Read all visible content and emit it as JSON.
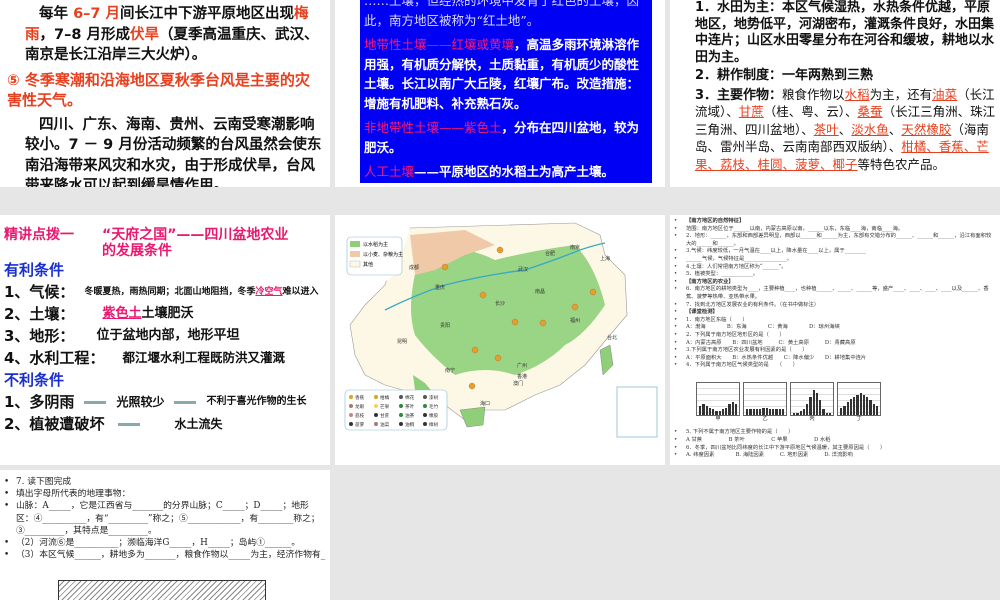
{
  "slide1": {
    "p1_a": "每年 ",
    "p1_red1": "6–7 月",
    "p1_b": "间长江中下游平原地区出现",
    "p1_red2": "梅雨",
    "p1_c": "，7–8 月形成",
    "p1_red3": "伏旱",
    "p1_d": "（夏季高温重庆、武汉、南京是长江沿岸三大火炉）。",
    "p2": "⑤ 冬季寒潮和沿海地区夏秋季台风是主要的灾害性天气。",
    "p3": "四川、广东、海南、贵州、云南受寒潮影响较小。7 － 9 月份活动频繁的台风虽然会使东南沿海带来风灾和水灾，由于形成伏旱，台风带来降水可以起到缓旱情作用。"
  },
  "slide2": {
    "p0": "……土壤，但经热的环境中发育了红色的土壤，因此，南方地区被称为“红土地”。",
    "p1_m": "地带性土壤——红壤或黄壤",
    "p1": "，高温多雨环境淋溶作用强，有机质分解快，土质黏重，有机质少的酸性土壤。长江以南广大丘陵，红壤广布。改造措施：增施有机肥料、补充熟石灰。",
    "p2_m": "非地带性土壤——紫色土",
    "p2": "，分布在四川盆地，较为肥沃。",
    "p3_m": "人工土壤",
    "p3": "——平原地区的水稻土为高产土壤。"
  },
  "slide3": {
    "p1": "1．水田为主：本区气候湿热，水热条件优越，平原地区，地势低平，河湖密布，灌溉条件良好，水田集中连片；山区水田零星分布在河谷和缓坡，耕地以水田为主。",
    "p2": "2．耕作制度：一年两熟到三熟",
    "p3_a": "3．主要作物：",
    "p3_b": "粮食作物以",
    "r1": "水稻",
    "p3_c": "为主，还有",
    "r2": "油菜",
    "p3_d": "（长江流域）、",
    "r3": "甘蔗",
    "p3_e": "（桂、粤、云）、",
    "r4": "桑蚕",
    "p3_f": "（长江三角洲、珠江三角洲、四川盆地）、",
    "r5": "茶叶",
    "p3_g": "、",
    "r6": "淡水鱼",
    "p3_h": "、",
    "r7": "天然橡胶",
    "p3_i": "（海南岛、雷州半岛、云南南部西双版纳）、",
    "r8": "柑橘、香蕉、芒果、荔枝、桂圆、菠萝、椰子",
    "p3_j": "等特色农产品。"
  },
  "slide4": {
    "title_a": "精讲点拨一",
    "title_b": "“天府之国”——四川盆地农业的发展条件",
    "fav": "有利条件",
    "rows": [
      {
        "k": "1、气候：",
        "v": "冬暖夏热，雨热同期；北面山地阻挡，冬季",
        "v_hl": "冷空气",
        "v2": "难以进入"
      },
      {
        "k": "2、土壤：",
        "v_hl": "紫色土",
        "v2": "土壤肥沃"
      },
      {
        "k": "3、地形：",
        "v": "位于盆地内部，地形平坦"
      },
      {
        "k": "4、水利工程：",
        "v": "都江堰水利工程既防洪又灌溉"
      }
    ],
    "unfav": "不利条件",
    "bad": [
      {
        "k": "1、多阴雨",
        "v": "光照较少",
        "v2": "不利于喜光作物的生长"
      },
      {
        "k": "2、植被遭破坏",
        "v": "水土流失"
      }
    ]
  },
  "slide5": {
    "legend": [
      "以水稻为主",
      "以小麦、杂粮为主",
      "其他"
    ],
    "cities": [
      "成都",
      "重庆",
      "武汉",
      "合肥",
      "南京",
      "上海",
      "长沙",
      "南昌",
      "贵阳",
      "昆明",
      "福州",
      "台北",
      "南宁",
      "广州",
      "香港",
      "澳门",
      "海口"
    ],
    "crops": [
      "香蕉",
      "柑橘",
      "棉花",
      "漆树",
      "龙眼",
      "芒果",
      "茶叶",
      "毛竹",
      "荔枝",
      "甘蔗",
      "油茶",
      "橡胶",
      "菠萝",
      "油菜",
      "油桐",
      "樟树"
    ],
    "colors": {
      "rice": "#8fcf7a",
      "wheat": "#efc9a8",
      "other": "#fdf8e6",
      "river": "#3aa9c9"
    }
  },
  "slide6": {
    "lines": [
      "【南方地区的自然特征】",
      "范围：南方地区位于______以南，内蒙古高原以南，______以东，东临____海，南临____海。",
      "2．地形：______，东部和西部差异明显，西部以______和______为主，东部有交错分布的______、______和______，沿江有面积较大的______和______。",
      "3.气候：纬度较低，一月气温在____以上，降水量在____以上，属于________",
      "______气候，气候特征是________________。",
      "4.土壤：人们常把南方地区称为“______”。",
      "5．植被类型：____________。",
      "【南方地区的农业】",
      "6．南方地区的耕地类型为____，主要种植____，也种植______、_____、______等，盛产____、____、____、____以及______、香蕉、菠萝等热带、亚热带水果。",
      "7．找到北方地区发展农业的有利条件。（在书中做标注）",
      "【课堂检测】",
      "1．南方地区东临（　　）",
      "A：渤海　　　　B：东海　　　　C：黄海　　　　D：琼州海峡",
      "2．下列属于南方地区地形区的是（　　）",
      "A：内蒙古高原　　B：四川盆地　　　C：黄土高原　　　D：青藏高原",
      "3.下列属于南方地区农业发展有利因素的是（　　）",
      "A：平原面积大　　B：水热条件优越　　C：降水偏少　　D：耕地集中连片",
      "4．下列属于南方地区气候类型的是　　（　　）"
    ],
    "chart_labels": [
      "甲",
      "乙",
      "丙",
      "丁"
    ],
    "lines2": [
      "5. 下列不属于南方地区主要作物的是（　　）",
      "A 甘蔗　　　　　B 茶叶　　　　　C 苹果　　　　　D 水稻",
      "6．冬季，四川盆地比同纬度的长江中下游平原地区气候温暖，其主要原因是（　　）",
      "A. 纬度因素　　　　B. 海陆因素　　　C. 地形因素　　　D. 洋流影响"
    ]
  },
  "slide7": {
    "lines": [
      "7. 读下图完成",
      "填出字母所代表的地理事物：",
      "山脉：A_____，它是江西省与_______的分界山脉；C_____；D_____；地形区：④__________，有“_________”称之；⑤____________，有________称之；③_________，其特点是_________。",
      "（2）河流⑥是__________；濒临海洋G_____，H_____；岛屿①______。",
      "（3）本区气候______，耕地多为_______，粮食作物以_____为主，经济作物有_"
    ]
  }
}
